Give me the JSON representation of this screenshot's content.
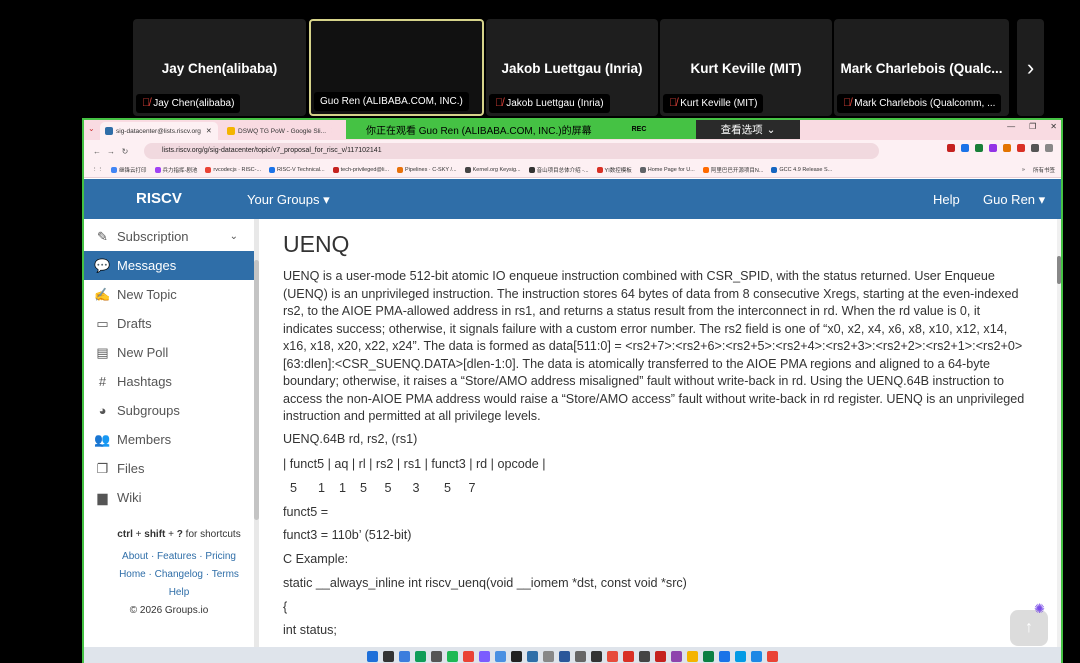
{
  "participants": [
    {
      "name": "Jay Chen(alibaba)",
      "label": "Jay Chen(alibaba)",
      "muted": true
    },
    {
      "name": "",
      "label": "Guo Ren (ALIBABA.COM, INC.)",
      "muted": false,
      "active": true
    },
    {
      "name": "Jakob Luettgau (Inria)",
      "label": "Jakob Luettgau (Inria)",
      "muted": true
    },
    {
      "name": "Kurt Keville (MIT)",
      "label": "Kurt Keville (MIT)",
      "muted": true
    },
    {
      "name": "Mark Charlebois (Qualc...",
      "label": "Mark Charlebois (Qualcomm, ...",
      "muted": true
    }
  ],
  "strip_next_icon": "chevron-right-icon",
  "browser": {
    "tabs": [
      {
        "title": "sig-datacenter@lists.riscv.org",
        "active": true
      },
      {
        "title": "DSWQ TG PoW - Google Sli...",
        "active": false
      }
    ],
    "share_banner": "你正在观看 Guo Ren (ALIBABA.COM, INC.)的屏幕",
    "rec_label": "REC",
    "view_options": "查看选项",
    "url": "lists.riscv.org/g/sig-datacenter/topic/v7_proposal_for_risc_v/117102141",
    "bookmarks": [
      "继锋云打印",
      "兵力指挥-剧池",
      "rvcodecjs · RISC-...",
      "RISC-V Technical...",
      "tech-privileged@li...",
      "Pipelines · C-SKY /...",
      "Kernel.org Keysig...",
      "音山项目总体介绍 -...",
      "YI数控模板",
      "Home Page for U...",
      "阿里巴巴开源项目N...",
      "GCC 4.9 Release S..."
    ],
    "bookmarks_more": "»",
    "all_bookmarks": "所有书签"
  },
  "site": {
    "brand": "RISCV",
    "your_groups": "Your Groups ▾",
    "help": "Help",
    "user": "Guo Ren ▾"
  },
  "sidebar": {
    "items": [
      {
        "label": "Subscription",
        "icon": "pencil-icon"
      },
      {
        "label": "Messages",
        "icon": "comments-icon",
        "active": true
      },
      {
        "label": "New Topic",
        "icon": "edit-icon"
      },
      {
        "label": "Drafts",
        "icon": "inbox-icon"
      },
      {
        "label": "New Poll",
        "icon": "chart-icon"
      },
      {
        "label": "Hashtags",
        "icon": "hashtag-icon"
      },
      {
        "label": "Subgroups",
        "icon": "pie-icon"
      },
      {
        "label": "Members",
        "icon": "users-icon"
      },
      {
        "label": "Files",
        "icon": "files-icon"
      },
      {
        "label": "Wiki",
        "icon": "book-icon"
      }
    ],
    "shortcut_prefix": "ctrl",
    "shortcut_mid": "shift",
    "shortcut_key": "?",
    "shortcut_suffix": "for shortcuts",
    "links_row1": "About · Features · Pricing",
    "links_row2": "Home · Changelog · Terms",
    "links_row3": "Help",
    "copyright": "© 2026 Groups.io"
  },
  "content": {
    "title": "UENQ",
    "paragraph": "UENQ is a user-mode 512-bit atomic IO enqueue instruction combined with CSR_SPID, with the status returned. User Enqueue (UENQ) is an unprivileged instruction. The instruction stores 64 bytes of data from 8 consecutive Xregs, starting at the even-indexed rs2, to the AIOE PMA-allowed address in rs1, and returns a status result from the interconnect in rd. When the rd value is 0, it indicates success; otherwise, it signals failure with a custom error number. The rs2 field is one of “x0, x2, x4, x6, x8, x10, x12, x14, x16, x18, x20, x22, x24”. The data is formed as data[511:0] = <rs2+7>:<rs2+6>:<rs2+5>:<rs2+4>:<rs2+3>:<rs2+2>:<rs2+1>:<rs2+0>[63:dlen]:<CSR_SUENQ.DATA>[dlen-1:0]. The data is atomically transferred to the AIOE PMA regions and aligned to a 64-byte boundary; otherwise, it raises a “Store/AMO address misaligned” fault without write-back in rd. Using the UENQ.64B instruction to access the non-AIOE PMA address would raise a “Store/AMO access” fault without write-back in rd register. UENQ is an unprivileged instruction and permitted at all privilege levels.",
    "lines": [
      "UENQ.64B rd, rs2, (rs1)",
      "| funct5 | aq | rl | rs2 | rs1 | funct3 | rd | opcode |",
      "  5      1    1    5     5      3       5     7",
      "funct5 =",
      "funct3 = 110b’ (512-bit)",
      "C Example:",
      "static __always_inline int riscv_uenq(void __iomem *dst, const void *src)",
      "{",
      "int status;"
    ]
  },
  "colors": {
    "nav_blue": "#2f6ea8",
    "share_green": "#45c244",
    "tab_pink": "#f9dbe2",
    "muted_red": "#e8453c"
  }
}
